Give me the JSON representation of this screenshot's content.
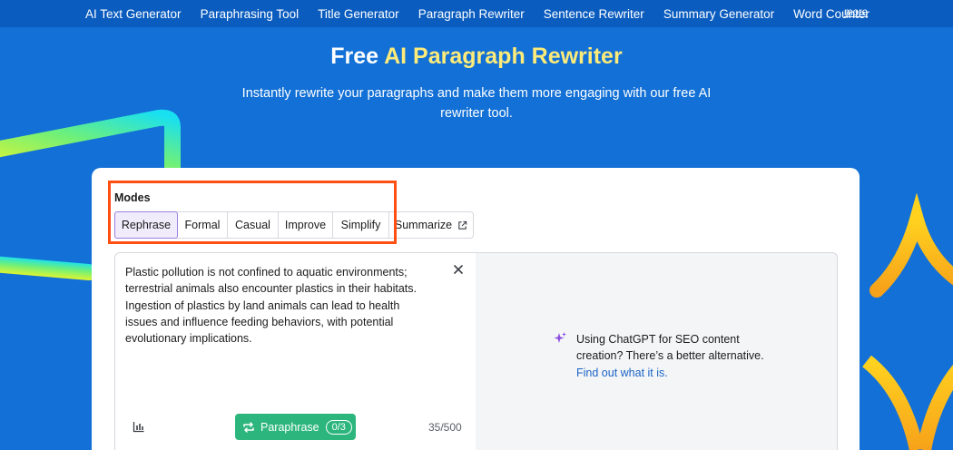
{
  "nav": {
    "items": [
      {
        "label": "AI Text Generator"
      },
      {
        "label": "Paraphrasing Tool"
      },
      {
        "label": "Title Generator"
      },
      {
        "label": "Paragraph Rewriter"
      },
      {
        "label": "Sentence Rewriter"
      },
      {
        "label": "Summary Generator"
      },
      {
        "label": "Word Counter"
      }
    ],
    "more_label": "more"
  },
  "hero": {
    "title_prefix": "Free ",
    "title_accent": "AI Paragraph Rewriter",
    "subtitle": "Instantly rewrite your paragraphs and make them more engaging with our free AI rewriter tool."
  },
  "modes": {
    "label": "Modes",
    "items": [
      {
        "label": "Rephrase",
        "active": true
      },
      {
        "label": "Formal"
      },
      {
        "label": "Casual"
      },
      {
        "label": "Improve"
      },
      {
        "label": "Simplify"
      },
      {
        "label": "Summarize",
        "icon": "external-link-icon"
      }
    ]
  },
  "editor": {
    "input_text": "Plastic pollution is not confined to aquatic environments; terrestrial animals also encounter plastics in their habitats. Ingestion of plastics by land animals can lead to health issues and influence feeding behaviors, with potential evolutionary implications.",
    "paraphrase_label": "Paraphrase",
    "usage_badge": "0/3",
    "char_count": "35/500"
  },
  "promo": {
    "text": "Using ChatGPT for SEO content creation? There’s a better alternative.",
    "link": "Find out what it is."
  },
  "colors": {
    "background": "#1270d6",
    "nav_background": "#0a5cbf",
    "accent_yellow": "#fdeb7a",
    "button_green": "#2cb67d",
    "highlight_orange": "#ff4f12",
    "link_blue": "#1a64c8",
    "active_mode_border": "#9a7fe0"
  },
  "icons": [
    "external-link-icon",
    "close-icon",
    "stats-icon",
    "repeat-icon",
    "sparkle-icon"
  ]
}
